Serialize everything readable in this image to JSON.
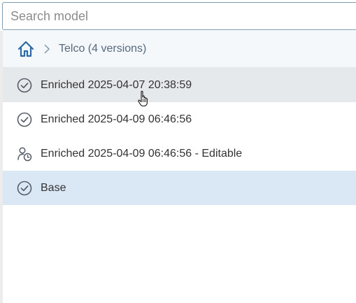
{
  "search": {
    "placeholder": "Search model",
    "value": ""
  },
  "breadcrumb": {
    "label": "Telco (4 versions)"
  },
  "versions": [
    {
      "label": "Enriched 2025-04-07 20:38:59",
      "icon": "check-circle-icon",
      "state": "hovered"
    },
    {
      "label": "Enriched 2025-04-09 06:46:56",
      "icon": "check-circle-icon",
      "state": "normal"
    },
    {
      "label": "Enriched 2025-04-09 06:46:56 - Editable",
      "icon": "user-clock-icon",
      "state": "normal"
    },
    {
      "label": "Base",
      "icon": "check-circle-icon",
      "state": "selected"
    }
  ],
  "colors": {
    "accent": "#2b6aa6",
    "hover_row": "#e6e9ec",
    "selected_row": "#d9e8f4",
    "breadcrumb_bg": "#f5f8fa"
  }
}
